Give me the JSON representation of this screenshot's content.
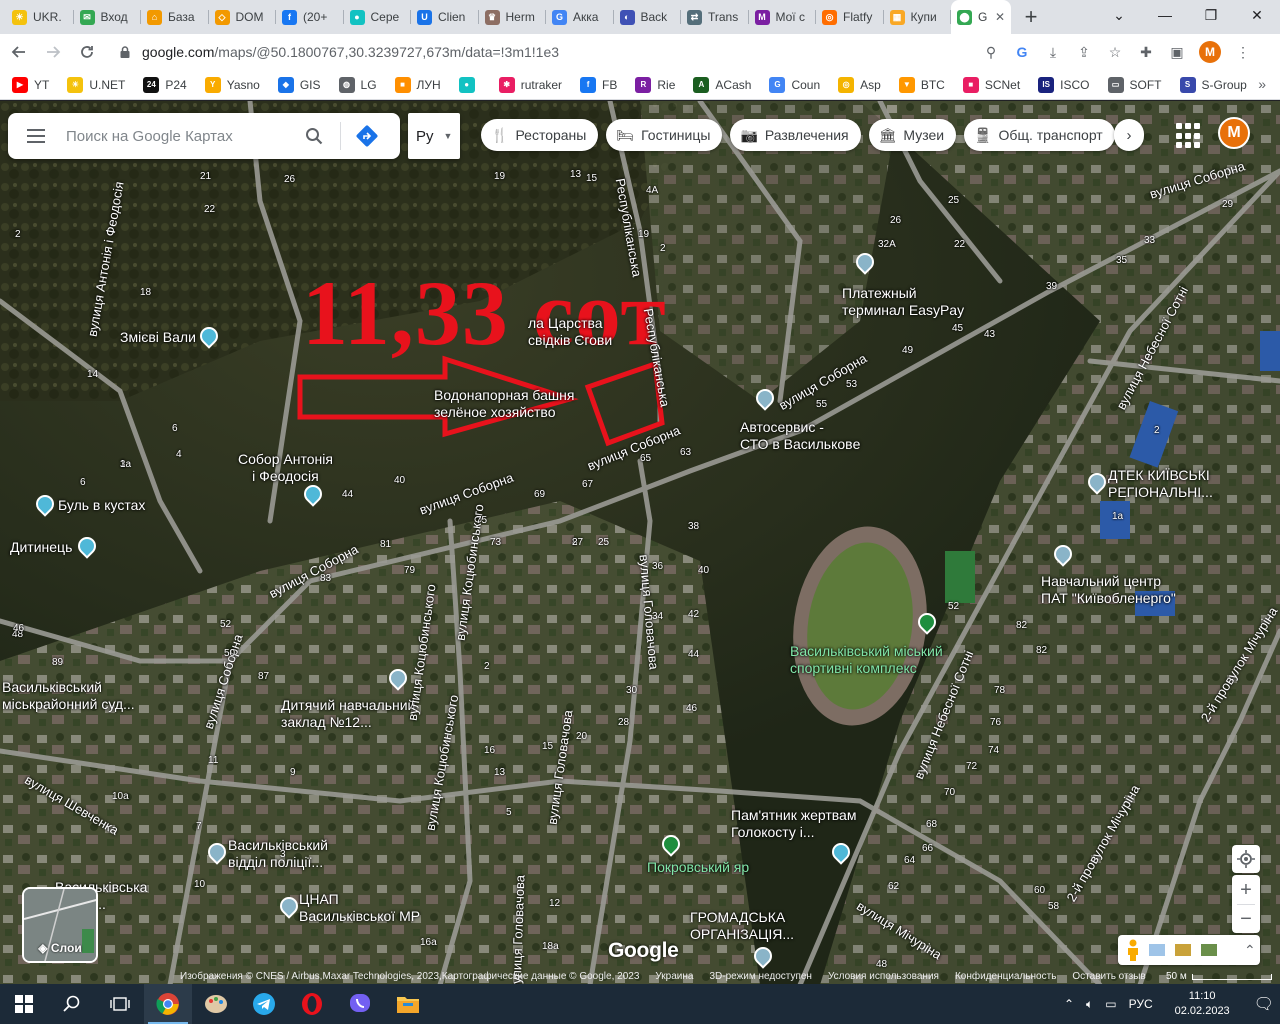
{
  "browser": {
    "tabs": [
      {
        "label": "UKR.",
        "color": "#f4c20d",
        "glyph": "☀"
      },
      {
        "label": "Вход",
        "color": "#34a853",
        "glyph": "✉"
      },
      {
        "label": "База",
        "color": "#f29900",
        "glyph": "⌂"
      },
      {
        "label": "DOM",
        "color": "#f29900",
        "glyph": "◇"
      },
      {
        "label": "(20+",
        "color": "#1877f2",
        "glyph": "f"
      },
      {
        "label": "Сере",
        "color": "#12c2c2",
        "glyph": "●"
      },
      {
        "label": "Clien",
        "color": "#1a73e8",
        "glyph": "U"
      },
      {
        "label": "Herm",
        "color": "#8d6e63",
        "glyph": "♛"
      },
      {
        "label": "Акка",
        "color": "#4285f4",
        "glyph": "G"
      },
      {
        "label": "Back",
        "color": "#3f51b5",
        "glyph": "◐"
      },
      {
        "label": "Trans",
        "color": "#546e7a",
        "glyph": "⇄"
      },
      {
        "label": "Мої с",
        "color": "#7b1fa2",
        "glyph": "M"
      },
      {
        "label": "Flatfy",
        "color": "#ff6d00",
        "glyph": "◎"
      },
      {
        "label": "Купи",
        "color": "#f9a825",
        "glyph": "▦"
      },
      {
        "label": "G",
        "color": "#34a853",
        "glyph": "⬤",
        "active": true
      }
    ],
    "new_tab": "+",
    "window_controls": [
      "⌄",
      "—",
      "❐",
      "✕"
    ],
    "url_domain": "google.com",
    "url_path": "/maps/@50.1800767,30.3239727,673m/data=!3m1!1e3",
    "profile_letter": "M",
    "bookmarks": [
      {
        "label": "YT",
        "color": "#ff0000",
        "glyph": "▶"
      },
      {
        "label": "U.NET",
        "color": "#f4c20d",
        "glyph": "☀"
      },
      {
        "label": "P24",
        "color": "#111111",
        "glyph": "24"
      },
      {
        "label": "Yasno",
        "color": "#f9ab00",
        "glyph": "Y"
      },
      {
        "label": "GIS",
        "color": "#1a73e8",
        "glyph": "◆"
      },
      {
        "label": "LG",
        "color": "#5f6368",
        "glyph": "◍"
      },
      {
        "label": "ЛУН",
        "color": "#ff8f00",
        "glyph": "■"
      },
      {
        "label": "",
        "color": "#12c2c2",
        "glyph": "●"
      },
      {
        "label": "rutraker",
        "color": "#e91e63",
        "glyph": "✱"
      },
      {
        "label": "FB",
        "color": "#1877f2",
        "glyph": "f"
      },
      {
        "label": "Rie",
        "color": "#7b1fa2",
        "glyph": "R"
      },
      {
        "label": "ACash",
        "color": "#1b5e20",
        "glyph": "A"
      },
      {
        "label": "Coun",
        "color": "#4285f4",
        "glyph": "G"
      },
      {
        "label": "Asp",
        "color": "#f4b400",
        "glyph": "◎"
      },
      {
        "label": "BTC",
        "color": "#ff9800",
        "glyph": "▼"
      },
      {
        "label": "SCNet",
        "color": "#e91e63",
        "glyph": "■"
      },
      {
        "label": "ISCO",
        "color": "#1a237e",
        "glyph": "IS"
      },
      {
        "label": "SOFT",
        "color": "#5f6368",
        "glyph": "▭"
      },
      {
        "label": "S-Group",
        "color": "#3949ab",
        "glyph": "S"
      }
    ],
    "bookmarks_more": "»"
  },
  "maps": {
    "search_placeholder": "Поиск на Google Картах",
    "lang_value": "Ру",
    "chips": [
      {
        "label": "Рестораны",
        "icon": "🍴"
      },
      {
        "label": "Гостиницы",
        "icon": "🛏"
      },
      {
        "label": "Развлечения",
        "icon": "📷"
      },
      {
        "label": "Музеи",
        "icon": "🏛"
      },
      {
        "label": "Общ. транспорт",
        "icon": "🚆"
      }
    ],
    "chips_next": "›",
    "avatar_letter": "M",
    "overlay_text": "11,33 сот",
    "layers_label": "Слои",
    "google_logo": "Google",
    "attribution": [
      "Изображения © CNES / Airbus,Maxar Technologies, 2023,Картографические данные © Google, 2023",
      "Украина",
      "3D-режим недоступен",
      "Условия использования",
      "Конфиденциальность",
      "Оставить отзыв"
    ],
    "scale_label": "50 м",
    "zoom_in": "+",
    "zoom_out": "−",
    "places": [
      {
        "text": "Змієві Вали",
        "icon": "#4fb8d8"
      },
      {
        "text": "Собор Антонія\nі Феодосія",
        "icon": "#4fb8d8"
      },
      {
        "text": "Буль в кустах",
        "icon": "#4fb8d8"
      },
      {
        "text": "Дитинець",
        "icon": "#4fb8d8"
      },
      {
        "text": "Платежный\nтерминал EasyPay",
        "icon": "#8ab4c8"
      },
      {
        "text": "Водонапорная башня\nзелёное хозяйство",
        "icon": ""
      },
      {
        "text": "ла Царства\nсвідків Єгови",
        "icon": ""
      },
      {
        "text": "Автосервис -\nСТО в Васильковe",
        "icon": "#8ab4c8"
      },
      {
        "text": "ДТЕК КИЇВСЬКІ\nРЕГІОНАЛЬНІ...",
        "icon": "#8ab4c8"
      },
      {
        "text": "Навчальний центр\nПАТ \"Київобленерго\"",
        "icon": "#8ab4c8"
      },
      {
        "text": "Васильківський міський\nспортивні комплекс",
        "icon": "#1e8e3e"
      },
      {
        "text": "Васильківський\nміськрайонний суд...",
        "icon": ""
      },
      {
        "text": "Дитячий навчальний\nзаклад №12...",
        "icon": "#8ab4c8"
      },
      {
        "text": "Пам'ятник жертвам\nГолокосту і...",
        "icon": "#4fb8d8"
      },
      {
        "text": "Покровський яр",
        "icon": "#1e8e3e"
      },
      {
        "text": "Васильківський\nвідділ поліції...",
        "icon": "#8ab4c8"
      },
      {
        "text": "ЦНАП\nВасильківської МР",
        "icon": "#8ab4c8"
      },
      {
        "text": "ГРОМАДСЬКА\nОРГАНІЗАЦІЯ...",
        "icon": "#8ab4c8"
      },
      {
        "text": "Васильківська\nсвітня...",
        "icon": ""
      }
    ],
    "streets": [
      "вулиця Соборна",
      "вулиця Соборна",
      "вулиця Соборна",
      "вулиця Соборна",
      "вулиця Соборна",
      "вулиця Соборна",
      "вулиця Небесної Сотні",
      "вулиця Небесної Сотні",
      "вулиця Антонія і Феодосія",
      "вулиця Коцюбинського",
      "вулиця Коцюбинського",
      "вулиця Коцюбинського",
      "вулиця Головачова",
      "вулиця Головачова",
      "вулиця Головачова",
      "вулиця Шевченка",
      "вулиця Мічуріна",
      "2-й провулок Мічуріна",
      "2-й провулок Мічуріна",
      "Республіканська",
      "Республіканська"
    ],
    "numbers": [
      "21",
      "26",
      "22",
      "19",
      "13",
      "15",
      "4А",
      "2",
      "19",
      "2",
      "18",
      "6",
      "14",
      "3",
      "4",
      "6",
      "40",
      "44",
      "38",
      "81",
      "79",
      "83",
      "87",
      "75",
      "73",
      "69",
      "67",
      "65",
      "63",
      "55",
      "53",
      "49",
      "45",
      "43",
      "39",
      "35",
      "33",
      "29",
      "22",
      "32А",
      "26",
      "25",
      "8",
      "27",
      "25",
      "36",
      "40",
      "42",
      "34",
      "44",
      "46",
      "30",
      "28",
      "20",
      "16",
      "15",
      "13",
      "11",
      "89",
      "52",
      "50",
      "48",
      "2",
      "1а",
      "82",
      "82",
      "78",
      "76",
      "74",
      "72",
      "70",
      "68",
      "66",
      "64",
      "62",
      "60",
      "58",
      "52",
      "48",
      "46",
      "1а",
      "3",
      "10",
      "12",
      "18а",
      "16а",
      "9",
      "5",
      "7",
      "10а",
      "2",
      "1"
    ]
  },
  "taskbar": {
    "lang": "РУС",
    "time": "11:10",
    "date": "02.02.2023"
  }
}
